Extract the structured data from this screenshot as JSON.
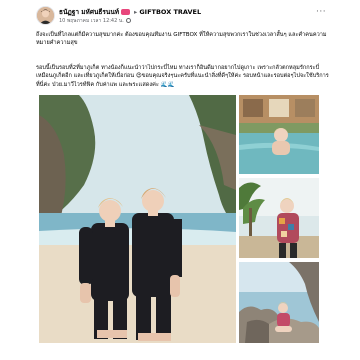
{
  "post": {
    "author": "ธนัฏฐา มหัศนธีรนนท์",
    "arrow": "▸",
    "page": "GIFTBOX TRAVEL",
    "timestamp": "10 พฤษภาคม เวลา 12:42 น.",
    "privacy_icon": "globe-icon",
    "more_icon": "ellipsis-icon",
    "more_label": "···",
    "caption_paragraph_1": "ถึงจะเป็นที่ไกลแต่ก็มีความสุขมากค่ะ ต้องขอบคุณทีมงาน GIFTBOX ที่ให้ความสุขพวกเราในช่วงเวลาสั้นๆ และคำคนความหมายคำความสุข",
    "caption_paragraph_2": "รอบนี้เป็นรอบที่2ที่มาภูเก็ต ทางน้องก็แนะนำว่าไปกระบี่ไหม ทางเราก็อินดีมากอยากไปดูเกาะ เพราะกลัวตกหลุมรักกระบี่เหมือนภูเก็ตอีก และเที่ยวภูเก็ตให้เบื่อก่อน 😍ขอบคุณจริงๆนะครับที่แนะนำสิ่งที่ดีๆให้ค่ะ รอบหน้าและรอบต่อๆไปจะใช้บริการที่นี่ค่ะ ป่วย.มาวีไวรท์ฟิค กับค่าแพ และพระเเสดงค่ะ 🌊🌊"
  },
  "photos": {
    "count": 4,
    "items": [
      {
        "name": "photo-couple-beach",
        "desc": "two people in black shirts on beach"
      },
      {
        "name": "photo-pool-villa",
        "desc": "person in pool"
      },
      {
        "name": "photo-person-palms",
        "desc": "person in colorful shirt"
      },
      {
        "name": "photo-rocky-beach",
        "desc": "person sitting on rocks"
      }
    ]
  },
  "colors": {
    "text": "#050505",
    "meta": "#65676b",
    "badge": "#e8467c",
    "link": "#216fdb"
  }
}
